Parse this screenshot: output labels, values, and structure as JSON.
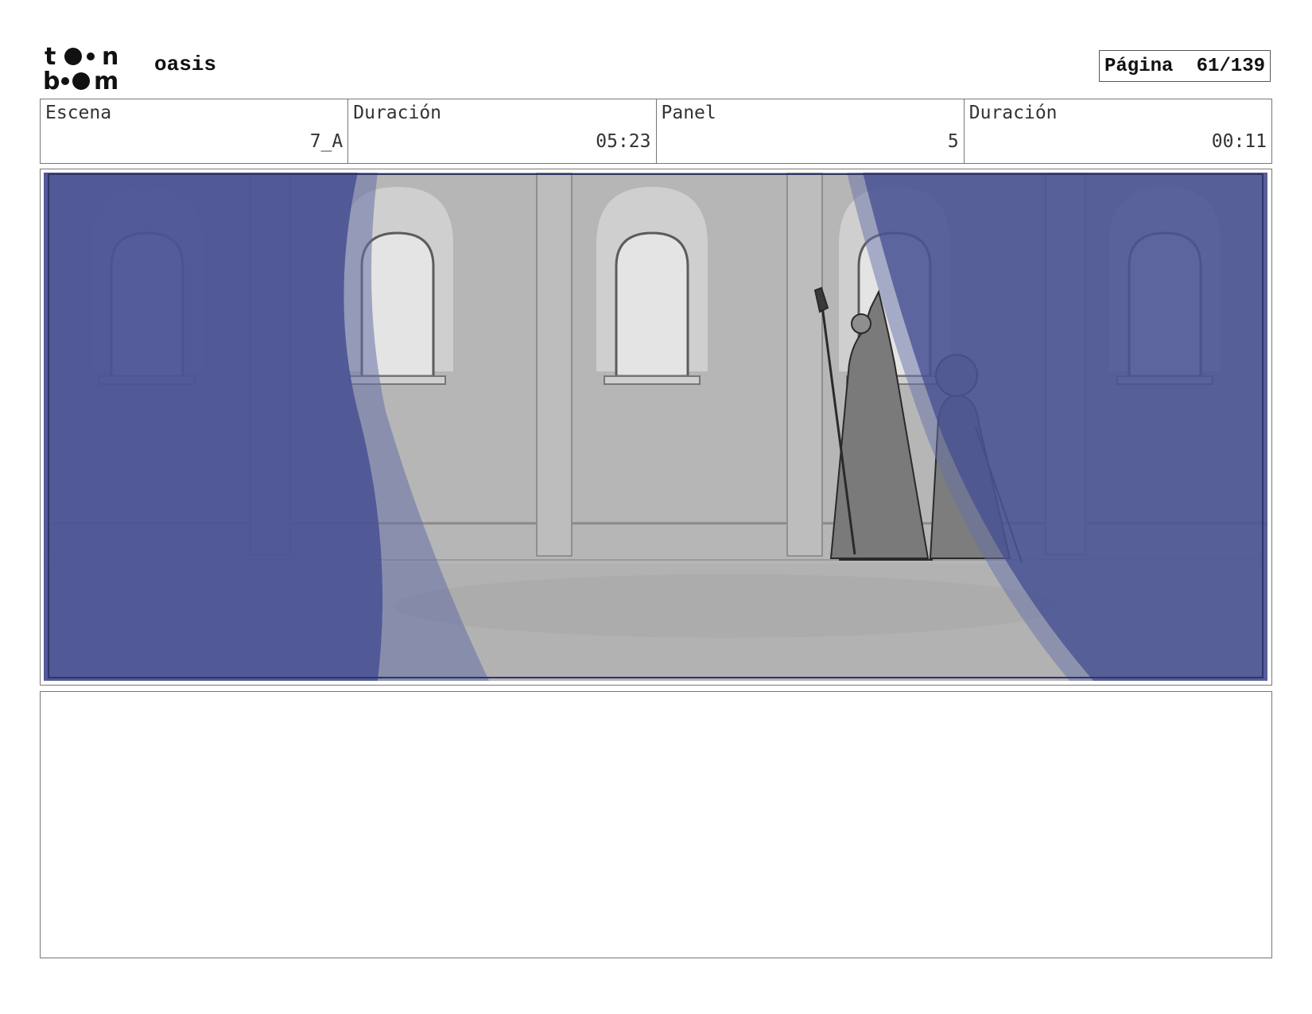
{
  "header": {
    "logo_text": "toon boom",
    "project_title": "oasis",
    "page_label": "Página",
    "page_number": "61/139"
  },
  "info": {
    "scene_label": "Escena",
    "scene_value": "7_A",
    "scene_duration_label": "Duración",
    "scene_duration_value": "05:23",
    "panel_label": "Panel",
    "panel_value": "5",
    "panel_duration_label": "Duración",
    "panel_duration_value": "00:11"
  },
  "panel": {
    "image_description_icon": "storyboard-sketch",
    "colors": {
      "blue_overlay": "#4a5395",
      "wall_gray": "#b6b6b6",
      "window_light": "#e4e4e4"
    }
  },
  "notes": {
    "text": ""
  }
}
